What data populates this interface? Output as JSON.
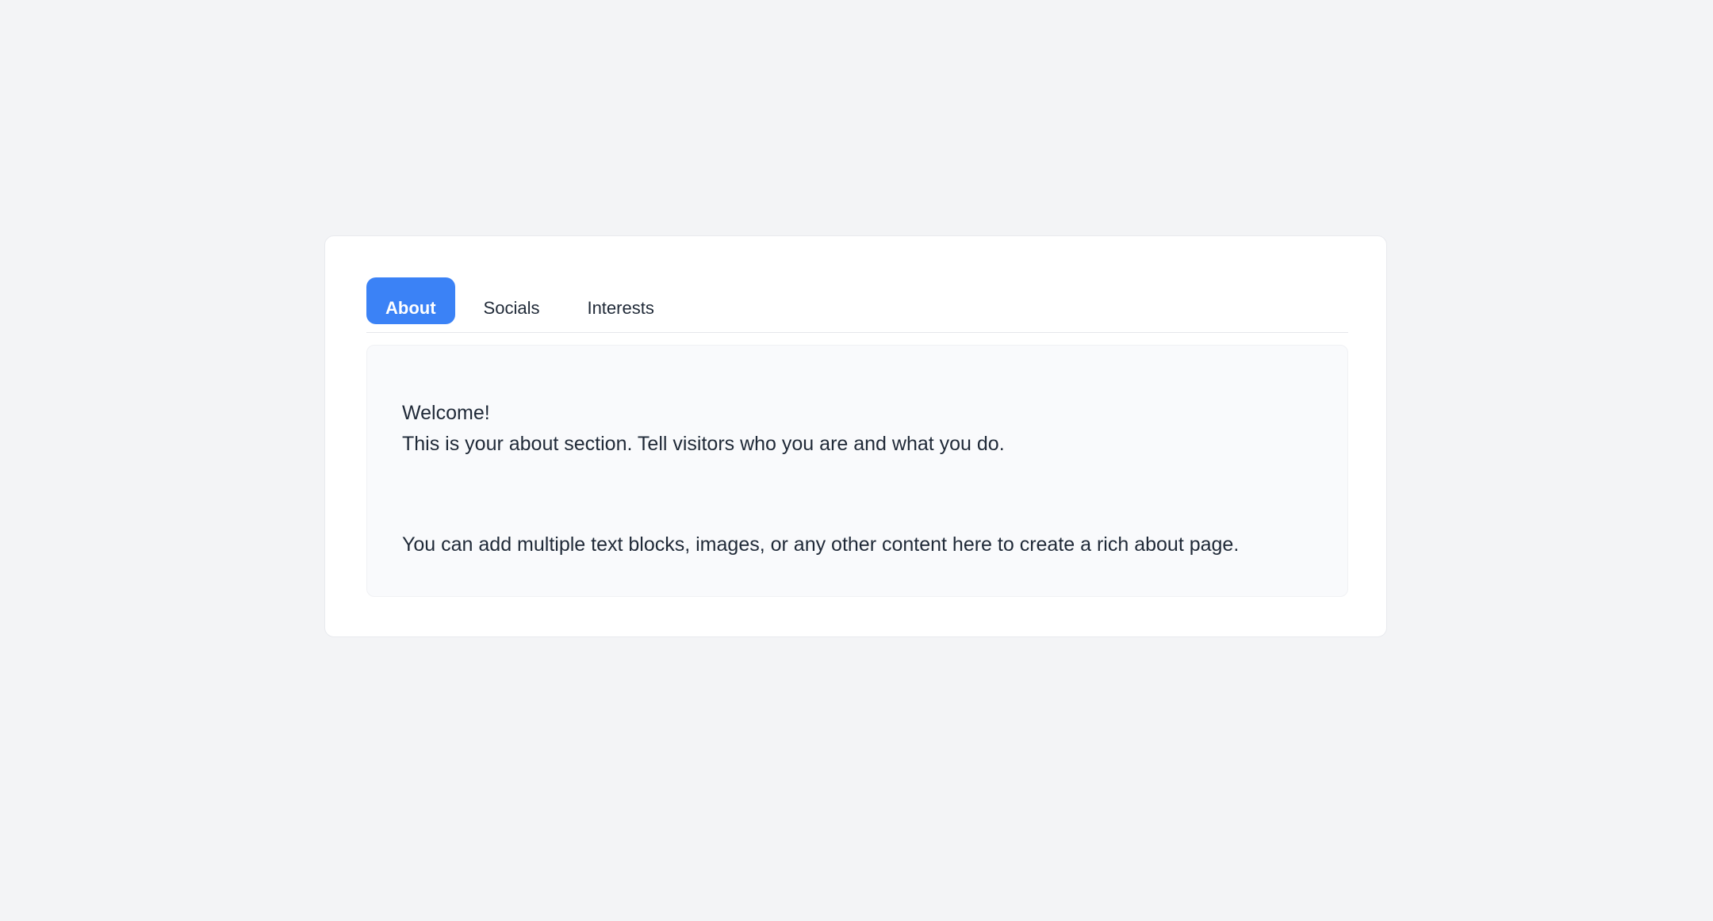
{
  "tabs": [
    {
      "label": "About",
      "active": true
    },
    {
      "label": "Socials",
      "active": false
    },
    {
      "label": "Interests",
      "active": false
    }
  ],
  "about": {
    "heading": "Welcome!",
    "intro": "This is your about section. Tell visitors who you are and what you do.",
    "body": "You can add multiple text blocks, images, or any other content here to create a rich about page."
  },
  "colors": {
    "accent": "#3b82f6",
    "background": "#f3f4f6",
    "card": "#ffffff",
    "panel": "#f9fafc",
    "text": "#1f2937"
  }
}
